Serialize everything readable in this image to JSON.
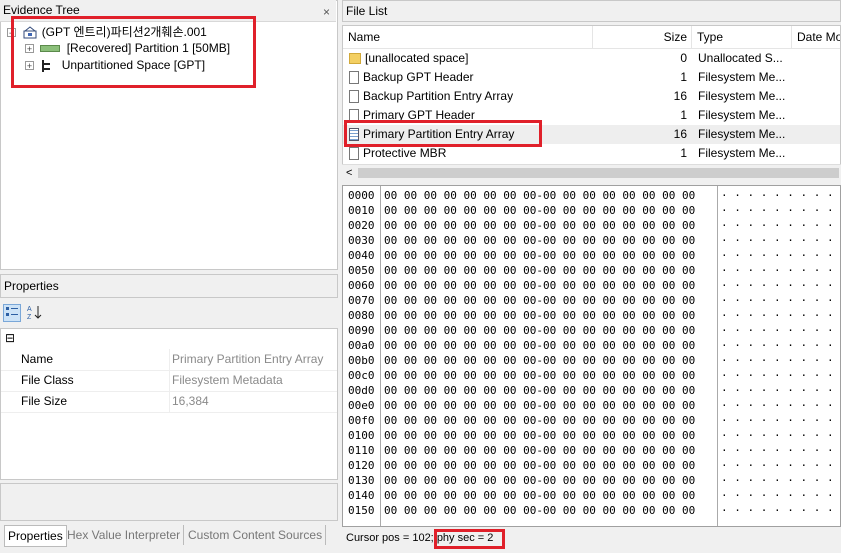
{
  "evidence_tree": {
    "title": "Evidence Tree",
    "close": "×",
    "root": {
      "label": "(GPT 엔트리)파티션2개훼손.001",
      "expander": "−"
    },
    "children": [
      {
        "label": "[Recovered] Partition 1 [50MB]",
        "expander": "+"
      },
      {
        "label": "Unpartitioned Space [GPT]",
        "expander": "+"
      }
    ]
  },
  "properties": {
    "title": "Properties",
    "section_toggle": "⊟",
    "rows": [
      {
        "name": "Name",
        "value": "Primary Partition Entry Array"
      },
      {
        "name": "File Class",
        "value": "Filesystem Metadata"
      },
      {
        "name": "File Size",
        "value": "16,384"
      }
    ],
    "tabs": [
      "Properties",
      "Hex Value Interpreter",
      "Custom Content Sources"
    ]
  },
  "file_list": {
    "title": "File List",
    "columns": [
      "Name",
      "Size",
      "Type",
      "Date Mo"
    ],
    "rows": [
      {
        "name": "[unallocated space]",
        "size": "0",
        "type": "Unallocated S...",
        "icon": "folder-icon"
      },
      {
        "name": "Backup GPT Header",
        "size": "1",
        "type": "Filesystem Me...",
        "icon": "file-icon"
      },
      {
        "name": "Backup Partition Entry Array",
        "size": "16",
        "type": "Filesystem Me...",
        "icon": "file-icon"
      },
      {
        "name": "Primary GPT Header",
        "size": "1",
        "type": "Filesystem Me...",
        "icon": "file-icon"
      },
      {
        "name": "Primary Partition Entry Array",
        "size": "16",
        "type": "Filesystem Me...",
        "icon": "grid-file-icon"
      },
      {
        "name": "Protective MBR",
        "size": "1",
        "type": "Filesystem Me...",
        "icon": "file-icon"
      }
    ],
    "selected_index": 4,
    "scroll_left": "<"
  },
  "hex_view": {
    "addresses": [
      "0000",
      "0010",
      "0020",
      "0030",
      "0040",
      "0050",
      "0060",
      "0070",
      "0080",
      "0090",
      "00a0",
      "00b0",
      "00c0",
      "00d0",
      "00e0",
      "00f0",
      "0100",
      "0110",
      "0120",
      "0130",
      "0140",
      "0150"
    ],
    "bytes_row": "00 00 00 00 00 00 00 00-00 00 00 00 00 00 00 00",
    "ascii_row": "· · · · · · · · · · · · · · · ·"
  },
  "status_bar": {
    "cursor": "Cursor pos = 102; ",
    "phy_sec": "phy sec = 2"
  },
  "colors": {
    "highlight_box": "#e0202a"
  }
}
